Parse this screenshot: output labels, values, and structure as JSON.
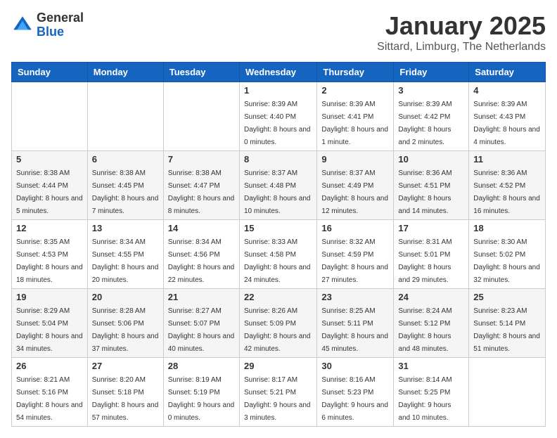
{
  "header": {
    "logo_general": "General",
    "logo_blue": "Blue",
    "title": "January 2025",
    "subtitle": "Sittard, Limburg, The Netherlands"
  },
  "days_of_week": [
    "Sunday",
    "Monday",
    "Tuesday",
    "Wednesday",
    "Thursday",
    "Friday",
    "Saturday"
  ],
  "weeks": [
    [
      {
        "day": "",
        "info": ""
      },
      {
        "day": "",
        "info": ""
      },
      {
        "day": "",
        "info": ""
      },
      {
        "day": "1",
        "info": "Sunrise: 8:39 AM\nSunset: 4:40 PM\nDaylight: 8 hours and 0 minutes."
      },
      {
        "day": "2",
        "info": "Sunrise: 8:39 AM\nSunset: 4:41 PM\nDaylight: 8 hours and 1 minute."
      },
      {
        "day": "3",
        "info": "Sunrise: 8:39 AM\nSunset: 4:42 PM\nDaylight: 8 hours and 2 minutes."
      },
      {
        "day": "4",
        "info": "Sunrise: 8:39 AM\nSunset: 4:43 PM\nDaylight: 8 hours and 4 minutes."
      }
    ],
    [
      {
        "day": "5",
        "info": "Sunrise: 8:38 AM\nSunset: 4:44 PM\nDaylight: 8 hours and 5 minutes."
      },
      {
        "day": "6",
        "info": "Sunrise: 8:38 AM\nSunset: 4:45 PM\nDaylight: 8 hours and 7 minutes."
      },
      {
        "day": "7",
        "info": "Sunrise: 8:38 AM\nSunset: 4:47 PM\nDaylight: 8 hours and 8 minutes."
      },
      {
        "day": "8",
        "info": "Sunrise: 8:37 AM\nSunset: 4:48 PM\nDaylight: 8 hours and 10 minutes."
      },
      {
        "day": "9",
        "info": "Sunrise: 8:37 AM\nSunset: 4:49 PM\nDaylight: 8 hours and 12 minutes."
      },
      {
        "day": "10",
        "info": "Sunrise: 8:36 AM\nSunset: 4:51 PM\nDaylight: 8 hours and 14 minutes."
      },
      {
        "day": "11",
        "info": "Sunrise: 8:36 AM\nSunset: 4:52 PM\nDaylight: 8 hours and 16 minutes."
      }
    ],
    [
      {
        "day": "12",
        "info": "Sunrise: 8:35 AM\nSunset: 4:53 PM\nDaylight: 8 hours and 18 minutes."
      },
      {
        "day": "13",
        "info": "Sunrise: 8:34 AM\nSunset: 4:55 PM\nDaylight: 8 hours and 20 minutes."
      },
      {
        "day": "14",
        "info": "Sunrise: 8:34 AM\nSunset: 4:56 PM\nDaylight: 8 hours and 22 minutes."
      },
      {
        "day": "15",
        "info": "Sunrise: 8:33 AM\nSunset: 4:58 PM\nDaylight: 8 hours and 24 minutes."
      },
      {
        "day": "16",
        "info": "Sunrise: 8:32 AM\nSunset: 4:59 PM\nDaylight: 8 hours and 27 minutes."
      },
      {
        "day": "17",
        "info": "Sunrise: 8:31 AM\nSunset: 5:01 PM\nDaylight: 8 hours and 29 minutes."
      },
      {
        "day": "18",
        "info": "Sunrise: 8:30 AM\nSunset: 5:02 PM\nDaylight: 8 hours and 32 minutes."
      }
    ],
    [
      {
        "day": "19",
        "info": "Sunrise: 8:29 AM\nSunset: 5:04 PM\nDaylight: 8 hours and 34 minutes."
      },
      {
        "day": "20",
        "info": "Sunrise: 8:28 AM\nSunset: 5:06 PM\nDaylight: 8 hours and 37 minutes."
      },
      {
        "day": "21",
        "info": "Sunrise: 8:27 AM\nSunset: 5:07 PM\nDaylight: 8 hours and 40 minutes."
      },
      {
        "day": "22",
        "info": "Sunrise: 8:26 AM\nSunset: 5:09 PM\nDaylight: 8 hours and 42 minutes."
      },
      {
        "day": "23",
        "info": "Sunrise: 8:25 AM\nSunset: 5:11 PM\nDaylight: 8 hours and 45 minutes."
      },
      {
        "day": "24",
        "info": "Sunrise: 8:24 AM\nSunset: 5:12 PM\nDaylight: 8 hours and 48 minutes."
      },
      {
        "day": "25",
        "info": "Sunrise: 8:23 AM\nSunset: 5:14 PM\nDaylight: 8 hours and 51 minutes."
      }
    ],
    [
      {
        "day": "26",
        "info": "Sunrise: 8:21 AM\nSunset: 5:16 PM\nDaylight: 8 hours and 54 minutes."
      },
      {
        "day": "27",
        "info": "Sunrise: 8:20 AM\nSunset: 5:18 PM\nDaylight: 8 hours and 57 minutes."
      },
      {
        "day": "28",
        "info": "Sunrise: 8:19 AM\nSunset: 5:19 PM\nDaylight: 9 hours and 0 minutes."
      },
      {
        "day": "29",
        "info": "Sunrise: 8:17 AM\nSunset: 5:21 PM\nDaylight: 9 hours and 3 minutes."
      },
      {
        "day": "30",
        "info": "Sunrise: 8:16 AM\nSunset: 5:23 PM\nDaylight: 9 hours and 6 minutes."
      },
      {
        "day": "31",
        "info": "Sunrise: 8:14 AM\nSunset: 5:25 PM\nDaylight: 9 hours and 10 minutes."
      },
      {
        "day": "",
        "info": ""
      }
    ]
  ]
}
